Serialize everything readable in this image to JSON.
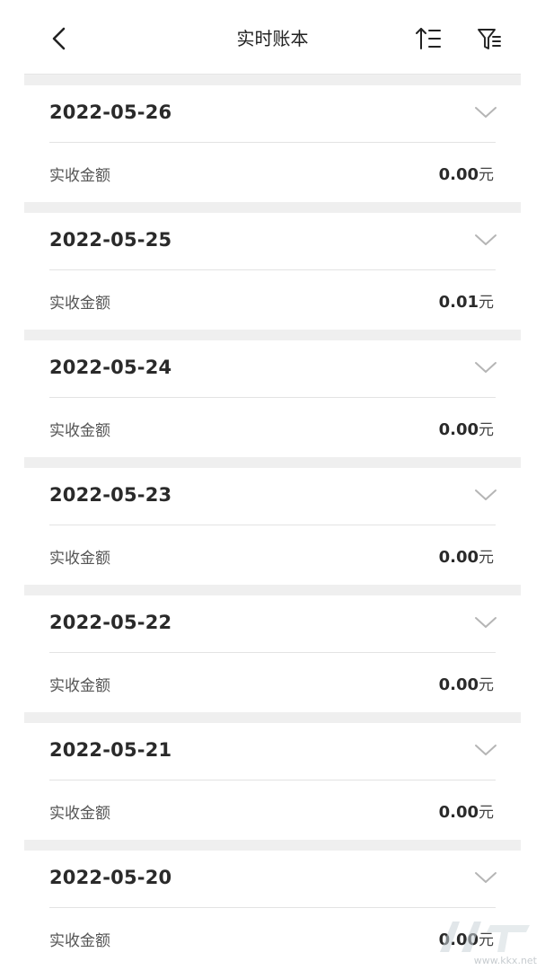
{
  "header": {
    "title": "实时账本"
  },
  "entries": [
    {
      "date": "2022-05-26",
      "label": "实收金额",
      "amount": "0.00",
      "unit": "元"
    },
    {
      "date": "2022-05-25",
      "label": "实收金额",
      "amount": "0.01",
      "unit": "元"
    },
    {
      "date": "2022-05-24",
      "label": "实收金额",
      "amount": "0.00",
      "unit": "元"
    },
    {
      "date": "2022-05-23",
      "label": "实收金额",
      "amount": "0.00",
      "unit": "元"
    },
    {
      "date": "2022-05-22",
      "label": "实收金额",
      "amount": "0.00",
      "unit": "元"
    },
    {
      "date": "2022-05-21",
      "label": "实收金额",
      "amount": "0.00",
      "unit": "元"
    },
    {
      "date": "2022-05-20",
      "label": "实收金额",
      "amount": "0.00",
      "unit": "元"
    }
  ],
  "icons": {
    "back": "back-arrow-icon",
    "sort": "sort-ascending-icon",
    "filter": "filter-icon",
    "expand": "chevron-down-icon"
  },
  "watermark": {
    "text": "www.kkx.net"
  },
  "colors": {
    "background": "#ffffff",
    "separator": "#efefef",
    "text_primary": "#2a2a2a",
    "text_secondary": "#555555"
  }
}
